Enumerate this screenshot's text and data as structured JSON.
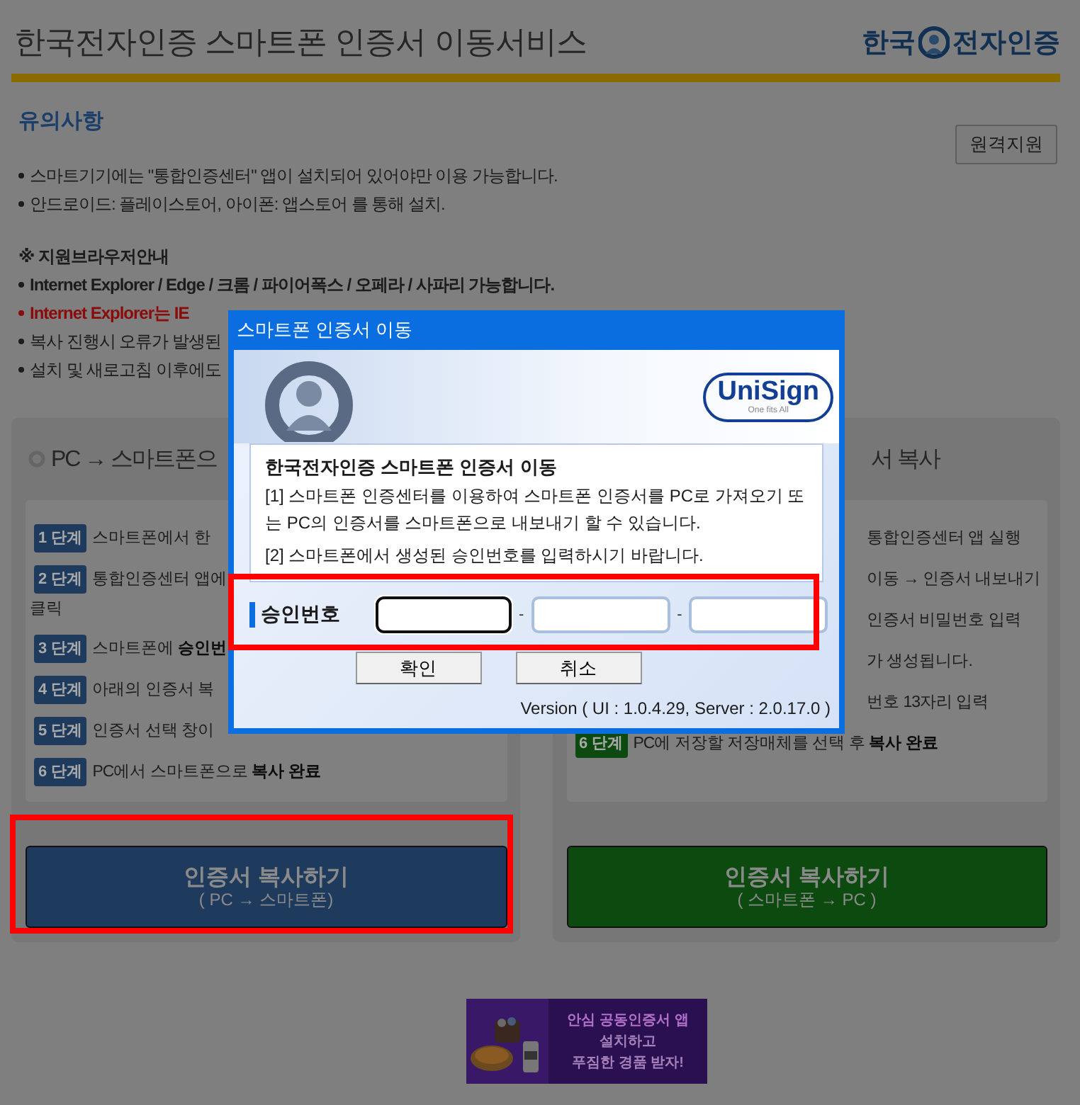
{
  "header": {
    "title": "한국전자인증 스마트폰 인증서 이동서비스",
    "logo": {
      "left": "한국",
      "right": "전자인증"
    }
  },
  "notice": {
    "heading": "유의사항",
    "remote_button": "원격지원",
    "items": [
      {
        "kind": "bullet",
        "text": "스마트기기에는 \"통합인증센터\" 앱이 설치되어 있어야만 이용 가능합니다."
      },
      {
        "kind": "bullet",
        "text": "안드로이드: 플레이스토어, 아이폰: 앱스토어 를 통해 설치."
      },
      {
        "kind": "heading",
        "text": "※ 지원브라우저안내"
      },
      {
        "kind": "strong",
        "text": "Internet Explorer / Edge / 크롬 / 파이어폭스 / 오페라 / 사파리 가능합니다."
      },
      {
        "kind": "warning",
        "text": "Internet Explorer는 IE"
      },
      {
        "kind": "bullet",
        "text": "복사 진행시 오류가 발생된"
      },
      {
        "kind": "bullet",
        "text": "설치 및 새로고침 이후에도"
      }
    ]
  },
  "panels": [
    {
      "color": "#1e3a5c",
      "title": "PC → 스마트폰으",
      "steps": [
        {
          "badge": "1 단계",
          "text": "스마트폰에서 한"
        },
        {
          "badge": "2 단계",
          "text": "통합인증센터 앱에",
          "wrap": "클릭"
        },
        {
          "badge": "3 단계",
          "text": "스마트폰에 **승인번**"
        },
        {
          "badge": "4 단계",
          "text": "아래의 인증서 복"
        },
        {
          "badge": "5 단계",
          "text": "인증서 선택 창이"
        },
        {
          "badge": "6 단계",
          "text": "PC에서 스마트폰으로 **복사 완료**"
        }
      ],
      "button": {
        "title": "인증서 복사하기",
        "subtitle": "( PC → 스마트폰)",
        "highlighted": true
      }
    },
    {
      "color": "#0c4a10",
      "title": "서 복사",
      "steps": [
        {
          "text": "통합인증센터 앱 실행"
        },
        {
          "text": "이동 → 인증서 내보내기"
        },
        {
          "text": "인증서 비밀번호 입력"
        },
        {
          "text": "가 생성됩니다."
        },
        {
          "text": "번호 13자리 입력"
        },
        {
          "badge": "6 단계",
          "text": "PC에 저장할 저장매체를 선택 후 **복사 완료**"
        }
      ],
      "button": {
        "title": "인증서 복사하기",
        "subtitle": "( 스마트폰 → PC )",
        "highlighted": false
      }
    }
  ],
  "dialog": {
    "title": "스마트폰 인증서 이동",
    "brand": "UniSign",
    "tagline": "One fits All",
    "heading": "한국전자인증 스마트폰 인증서 이동",
    "paragraphs": [
      "[1] 스마트폰 인증센터를 이용하여 스마트폰 인증서를 PC로 가져오기 또는 PC의 인증서를 스마트폰으로 내보내기 할 수 있습니다.",
      "[2] 스마트폰에서 생성된 승인번호를 입력하시기 바랍니다."
    ],
    "field_label": "승인번호",
    "highlighted": true,
    "fields": [
      {
        "focused": true
      },
      {
        "focused": false,
        "separator": "-"
      },
      {
        "focused": false,
        "separator": "-"
      }
    ],
    "buttons": [
      "확인",
      "취소"
    ],
    "version": "Version ( UI : 1.0.4.29, Server : 2.0.17.0 )"
  },
  "ad": {
    "lines": [
      "안심 공동인증서 앱",
      "설치하고",
      "푸짐한 경품 받자!"
    ]
  }
}
